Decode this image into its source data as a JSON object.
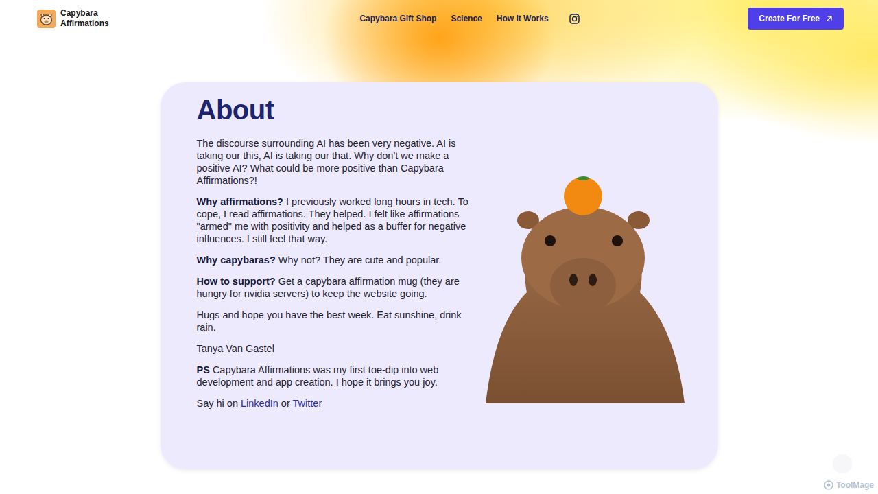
{
  "brand": {
    "line1": "Capybara",
    "line2": "Affirmations"
  },
  "nav": [
    {
      "label": "Capybara Gift Shop"
    },
    {
      "label": "Science"
    },
    {
      "label": "How It Works"
    }
  ],
  "cta": {
    "label": "Create For Free"
  },
  "about": {
    "title": "About",
    "paragraphs": [
      {
        "segments": [
          {
            "text": "The discourse surrounding AI has been very negative. AI is taking our this, AI is taking our that. Why don't we make a positive AI? What could be more positive than Capybara Affirmations?!",
            "kind": "plain"
          }
        ]
      },
      {
        "segments": [
          {
            "text": "Why affirmations? ",
            "kind": "bold"
          },
          {
            "text": "I previously worked long hours in tech. To cope, I read affirmations. They helped. I felt like affirmations \"armed\" me with positivity and helped as a buffer for negative influences. I still feel that way.",
            "kind": "plain"
          }
        ]
      },
      {
        "segments": [
          {
            "text": "Why capybaras? ",
            "kind": "bold"
          },
          {
            "text": "Why not? They are cute and popular.",
            "kind": "plain"
          }
        ]
      },
      {
        "segments": [
          {
            "text": "How to support? ",
            "kind": "bold"
          },
          {
            "text": "Get a capybara affirmation mug (they are hungry for nvidia servers) to keep the website going.",
            "kind": "plain"
          }
        ]
      },
      {
        "segments": [
          {
            "text": "Hugs and hope you have the best week. Eat sunshine, drink rain.",
            "kind": "plain"
          }
        ]
      },
      {
        "segments": [
          {
            "text": "Tanya Van Gastel",
            "kind": "plain"
          }
        ]
      },
      {
        "segments": [
          {
            "text": "PS ",
            "kind": "bold"
          },
          {
            "text": "Capybara Affirmations was my first toe-dip into web development and app creation. I hope it brings you joy.",
            "kind": "plain"
          }
        ]
      },
      {
        "segments": [
          {
            "text": "Say hi on ",
            "kind": "plain"
          },
          {
            "text": "LinkedIn",
            "kind": "link"
          },
          {
            "text": " or ",
            "kind": "plain"
          },
          {
            "text": "Twitter",
            "kind": "link"
          }
        ]
      }
    ]
  },
  "watermark": "ToolMage"
}
